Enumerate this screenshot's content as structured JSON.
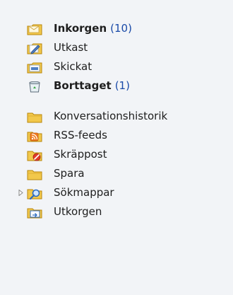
{
  "folders": [
    {
      "id": "inkorgen",
      "label": "Inkorgen",
      "count": "(10)",
      "bold": true,
      "icon": "inbox-icon"
    },
    {
      "id": "utkast",
      "label": "Utkast",
      "count": "",
      "bold": false,
      "icon": "drafts-icon"
    },
    {
      "id": "skickat",
      "label": "Skickat",
      "count": "",
      "bold": false,
      "icon": "sent-icon"
    },
    {
      "id": "borttaget",
      "label": "Borttaget",
      "count": "(1)",
      "bold": true,
      "icon": "deleted-items-icon"
    },
    {
      "id": "konversationshistorik",
      "label": "Konversationshistorik",
      "count": "",
      "bold": false,
      "icon": "folder-icon"
    },
    {
      "id": "rss",
      "label": "RSS-feeds",
      "count": "",
      "bold": false,
      "icon": "rss-folder-icon"
    },
    {
      "id": "skrappost",
      "label": "Skräppost",
      "count": "",
      "bold": false,
      "icon": "junk-folder-icon"
    },
    {
      "id": "spara",
      "label": "Spara",
      "count": "",
      "bold": false,
      "icon": "folder-icon"
    },
    {
      "id": "sokmappar",
      "label": "Sökmappar",
      "count": "",
      "bold": false,
      "icon": "search-folder-icon",
      "expandable": true,
      "expanded": false
    },
    {
      "id": "utkorgen",
      "label": "Utkorgen",
      "count": "",
      "bold": false,
      "icon": "outbox-icon"
    }
  ],
  "colors": {
    "background": "#f2f4f7",
    "count_text": "#1a4aa8",
    "folder_yellow": "#f2c84b"
  }
}
